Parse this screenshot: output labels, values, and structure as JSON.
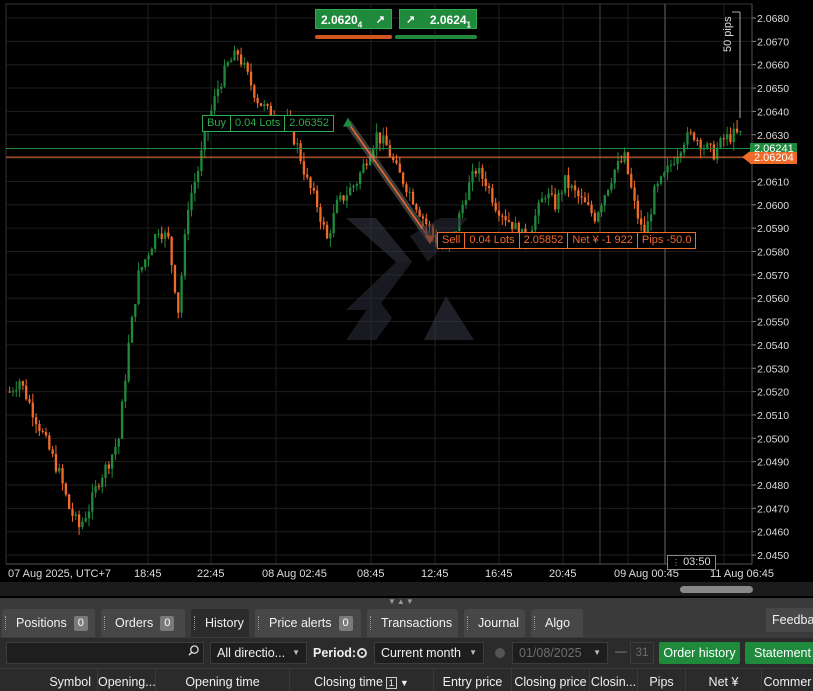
{
  "chart": {
    "bid_price": "2.06204",
    "ask_price": "2.06241",
    "sell_quote_main": "2.0620",
    "sell_quote_sub": "4",
    "buy_quote_main": "2.0624",
    "buy_quote_sub": "1",
    "pips_measure": "50 pips",
    "crosshair_time": "03:50",
    "price_axis": [
      "2.0680",
      "2.0670",
      "2.0660",
      "2.0650",
      "2.0640",
      "2.0630",
      "2.0620",
      "2.0610",
      "2.0600",
      "2.0590",
      "2.0580",
      "2.0570",
      "2.0560",
      "2.0550",
      "2.0540",
      "2.0530",
      "2.0520",
      "2.0510",
      "2.0500",
      "2.0490",
      "2.0480",
      "2.0470",
      "2.0460",
      "2.0450"
    ],
    "time_axis": [
      "07 Aug 2025, UTC+7",
      "18:45",
      "22:45",
      "08 Aug 02:45",
      "08:45",
      "12:45",
      "16:45",
      "20:45",
      "09 Aug 00:45",
      "11 Aug 06:45"
    ],
    "buy_trade": {
      "side": "Buy",
      "volume": "0.04 Lots",
      "price": "2.06352"
    },
    "sell_trade": {
      "side": "Sell",
      "volume": "0.04 Lots",
      "price": "2.05852",
      "net": "Net ¥ -1 922",
      "pips": "Pips -50.0"
    },
    "colors": {
      "bull": "#1f8a3c",
      "bear": "#f06a2a",
      "grid": "#1e1e1e",
      "background": "#000000"
    }
  },
  "tabs": [
    {
      "label": "Positions",
      "count": "0"
    },
    {
      "label": "Orders",
      "count": "0"
    },
    {
      "label": "History"
    },
    {
      "label": "Price alerts",
      "count": "0"
    },
    {
      "label": "Transactions"
    },
    {
      "label": "Journal"
    },
    {
      "label": "Algo"
    }
  ],
  "feedback_label": "Feedba",
  "toolbar": {
    "direction": "All directio...",
    "period_label": "Period:",
    "period_value": "Current month",
    "date_from": "01/08/2025",
    "date_to": "31",
    "order_history": "Order history",
    "statement": "Statement"
  },
  "table_columns": [
    "Symbol",
    "Opening...",
    "Opening time",
    "Closing time",
    "Entry price",
    "Closing price",
    "Closin...",
    "Pips",
    "Net ¥",
    "Commer"
  ],
  "closing_time_sort": "1"
}
